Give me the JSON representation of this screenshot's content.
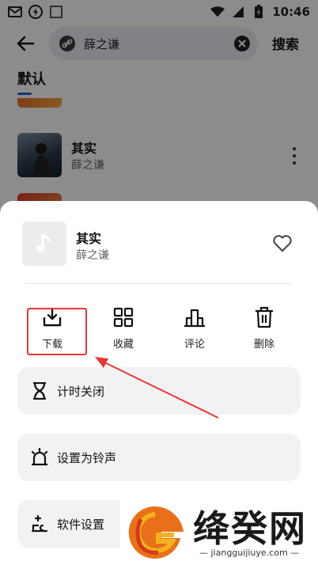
{
  "status": {
    "time": "10:46",
    "left_icons": [
      "gmail-icon",
      "flash-icon",
      "translate-icon"
    ],
    "right_icons": [
      "wifi-icon",
      "signal-icon",
      "battery-charging-icon"
    ],
    "notif_letter": "A"
  },
  "search": {
    "query": "薛之谦",
    "button_label": "搜索"
  },
  "tabs": {
    "default_label": "默认"
  },
  "results": [
    {
      "title": "其实",
      "artist": "薛之谦"
    }
  ],
  "sheet": {
    "song_title": "其实",
    "artist": "薛之谦",
    "actions": [
      {
        "label": "下载",
        "icon": "download-icon"
      },
      {
        "label": "收藏",
        "icon": "grid-icon"
      },
      {
        "label": "评论",
        "icon": "comment-icon"
      },
      {
        "label": "删除",
        "icon": "trash-icon"
      }
    ],
    "menu": [
      {
        "label": "计时关闭",
        "icon": "hourglass-icon"
      },
      {
        "label": "设置为铃声",
        "icon": "alarm-icon"
      },
      {
        "label": "软件设置",
        "icon": "settings-icon"
      }
    ]
  },
  "watermark": {
    "name": "绛癸网",
    "url": "jiangguijiuye.com"
  },
  "colors": {
    "highlight": "#e53935",
    "tab_accent": "#2a5dcf",
    "card_bg": "#f2f2f4"
  }
}
